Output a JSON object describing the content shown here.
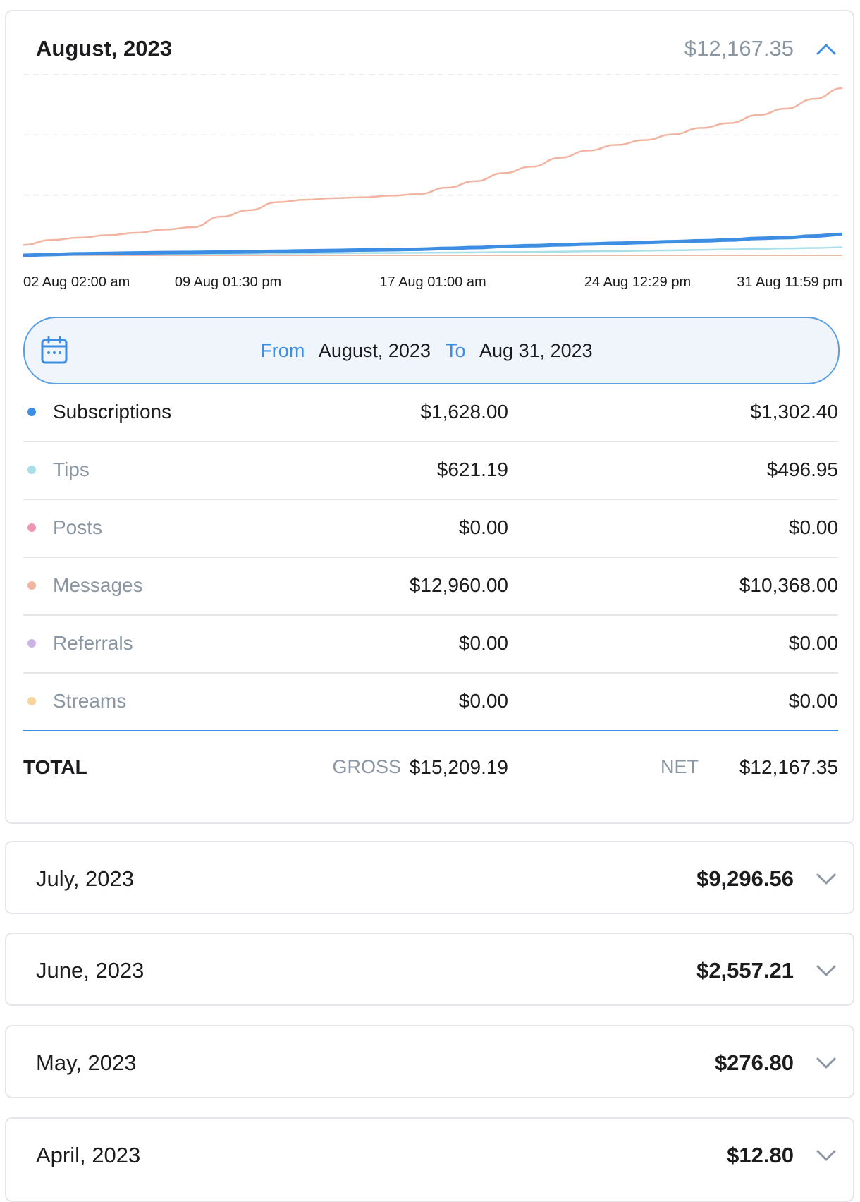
{
  "current": {
    "title": "August, 2023",
    "total": "$12,167.35",
    "range": {
      "from_label": "From",
      "from_value": "August, 2023",
      "to_label": "To",
      "to_value": "Aug 31, 2023"
    },
    "categories": [
      {
        "name": "Subscriptions",
        "gross": "$1,628.00",
        "net": "$1,302.40",
        "color": "#3d8ee3"
      },
      {
        "name": "Tips",
        "gross": "$621.19",
        "net": "$496.95",
        "color": "#a8dfe8"
      },
      {
        "name": "Posts",
        "gross": "$0.00",
        "net": "$0.00",
        "color": "#ea96b4"
      },
      {
        "name": "Messages",
        "gross": "$12,960.00",
        "net": "$10,368.00",
        "color": "#f2b4a0"
      },
      {
        "name": "Referrals",
        "gross": "$0.00",
        "net": "$0.00",
        "color": "#c9b3e3"
      },
      {
        "name": "Streams",
        "gross": "$0.00",
        "net": "$0.00",
        "color": "#f6d49a"
      }
    ],
    "totals": {
      "label": "TOTAL",
      "gross_label": "GROSS",
      "gross": "$15,209.19",
      "net_label": "NET",
      "net": "$12,167.35"
    }
  },
  "chart_data": {
    "type": "line",
    "x_ticks": [
      "02 Aug 02:00 am",
      "09 Aug 01:30 pm",
      "17 Aug 01:00 am",
      "24 Aug 12:29 pm",
      "31 Aug 11:59 pm"
    ],
    "x": [
      2,
      3,
      4,
      5,
      6,
      7,
      8,
      9,
      10,
      11,
      12,
      13,
      14,
      15,
      16,
      17,
      18,
      19,
      20,
      21,
      22,
      23,
      24,
      25,
      26,
      27,
      28,
      29,
      30,
      31
    ],
    "ylim": [
      0,
      11200
    ],
    "grid": true,
    "series": [
      {
        "color": "#f2b4a0",
        "values": [
          650,
          950,
          1100,
          1250,
          1400,
          1600,
          1750,
          2400,
          2800,
          3300,
          3450,
          3550,
          3600,
          3700,
          3800,
          4200,
          4600,
          5100,
          5500,
          6050,
          6500,
          6850,
          7150,
          7500,
          7900,
          8200,
          8700,
          9100,
          9700,
          10368
        ]
      },
      {
        "color": "#3d8ee3",
        "values": [
          0,
          50,
          100,
          120,
          150,
          170,
          180,
          200,
          220,
          250,
          280,
          300,
          330,
          350,
          380,
          430,
          480,
          550,
          600,
          650,
          700,
          750,
          800,
          850,
          900,
          950,
          1050,
          1100,
          1200,
          1302
        ]
      },
      {
        "color": "#a8dfe8",
        "values": [
          20,
          30,
          40,
          50,
          60,
          70,
          80,
          90,
          100,
          110,
          120,
          130,
          140,
          150,
          160,
          170,
          180,
          200,
          210,
          230,
          250,
          270,
          290,
          310,
          340,
          370,
          400,
          430,
          460,
          497
        ]
      },
      {
        "color": "#e8a48f",
        "values": [
          0,
          0,
          0,
          0,
          0,
          0,
          0,
          0,
          0,
          0,
          0,
          0,
          0,
          0,
          0,
          0,
          0,
          0,
          0,
          0,
          0,
          0,
          0,
          0,
          0,
          0,
          0,
          0,
          0,
          0
        ]
      }
    ]
  },
  "months": [
    {
      "title": "July, 2023",
      "total": "$9,296.56"
    },
    {
      "title": "June, 2023",
      "total": "$2,557.21"
    },
    {
      "title": "May, 2023",
      "total": "$276.80"
    },
    {
      "title": "April, 2023",
      "total": "$12.80"
    }
  ],
  "icons": {
    "collapse": "chevron-up-icon",
    "expand": "chevron-down-icon",
    "calendar": "calendar-icon"
  }
}
